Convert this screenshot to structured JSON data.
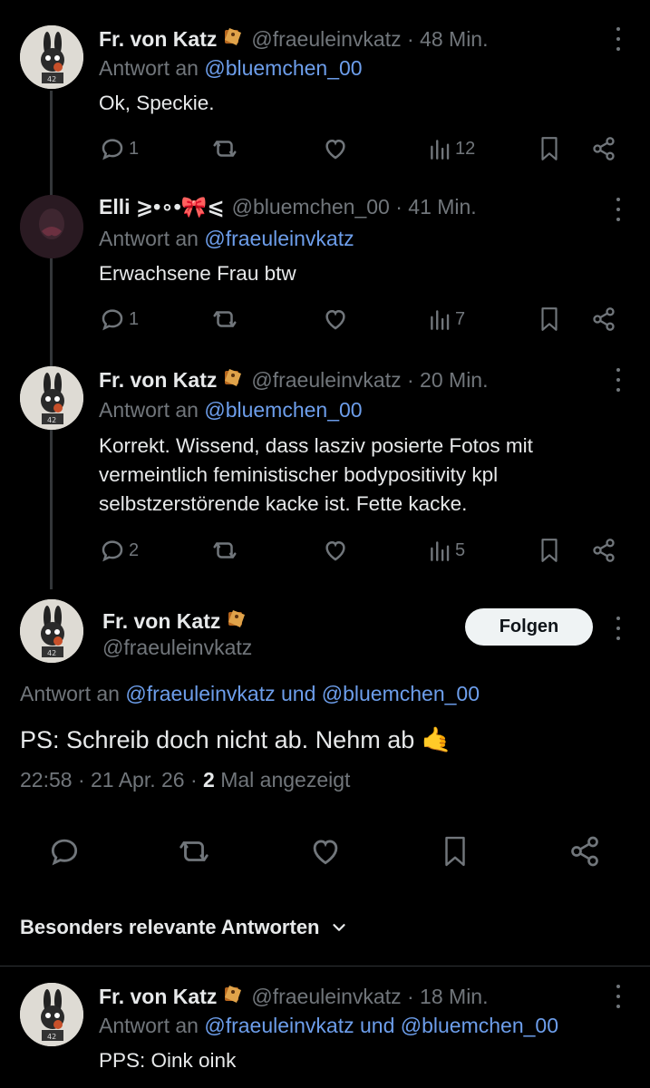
{
  "tweets": [
    {
      "name": "Fr. von Katz",
      "handle": "@fraeuleinvkatz · 48 Min.",
      "reply_prefix": "Antwort an ",
      "reply_to": "@bluemchen_00",
      "text": "Ok, Speckie.",
      "replies": "1",
      "retweets": "",
      "likes": "",
      "views": "12"
    },
    {
      "name": "Elli ⩾•∘•🎀⩽",
      "handle": "@bluemchen_00 · 41 Min.",
      "reply_prefix": "Antwort an ",
      "reply_to": "@fraeuleinvkatz",
      "text": "Erwachsene Frau btw",
      "replies": "1",
      "retweets": "",
      "likes": "",
      "views": "7"
    },
    {
      "name": "Fr. von Katz",
      "handle": "@fraeuleinvkatz · 20 Min.",
      "reply_prefix": "Antwort an ",
      "reply_to": "@bluemchen_00",
      "text_lines": [
        "Korrekt. Wissend, dass lasziv posierte Fotos mit",
        "vermeintlich feministischer bodypositivity kpl",
        "selbstzerstörende kacke ist. Fette kacke."
      ],
      "replies": "2",
      "retweets": "",
      "likes": "",
      "views": "5"
    }
  ],
  "main_tweet": {
    "name": "Fr. von Katz",
    "handle": "@fraeuleinvkatz",
    "follow_label": "Folgen",
    "reply_prefix": "Antwort an ",
    "reply_to_1": "@fraeuleinvkatz",
    "reply_and": " und ",
    "reply_to_2": "@bluemchen_00",
    "text": "PS: Schreib doch nicht ab. Nehm ab 🤙",
    "time": "22:58 · 21 Apr. 26 · ",
    "view_count": "2",
    "view_suffix": " Mal angezeigt"
  },
  "relevant_label": "Besonders relevante Antworten",
  "bottom_tweet": {
    "name": "Fr. von Katz",
    "handle": "@fraeuleinvkatz · 18 Min.",
    "reply_prefix": "Antwort an ",
    "reply_to_1": "@fraeuleinvkatz",
    "reply_and": " und ",
    "reply_to_2": "@bluemchen_00",
    "text": "PPS: Oink oink"
  },
  "icons": {
    "reply": "reply-icon",
    "retweet": "retweet-icon",
    "like": "heart-icon",
    "views": "views-chart-icon",
    "bookmark": "bookmark-icon",
    "share": "share-icon",
    "more": "more-dots-icon",
    "name_badge": "label-badge-icon"
  },
  "colors": {
    "background": "#000000",
    "text": "#e7e9ea",
    "muted": "#71767b",
    "link": "#6d9eeb",
    "follow_bg": "#eff3f4"
  }
}
